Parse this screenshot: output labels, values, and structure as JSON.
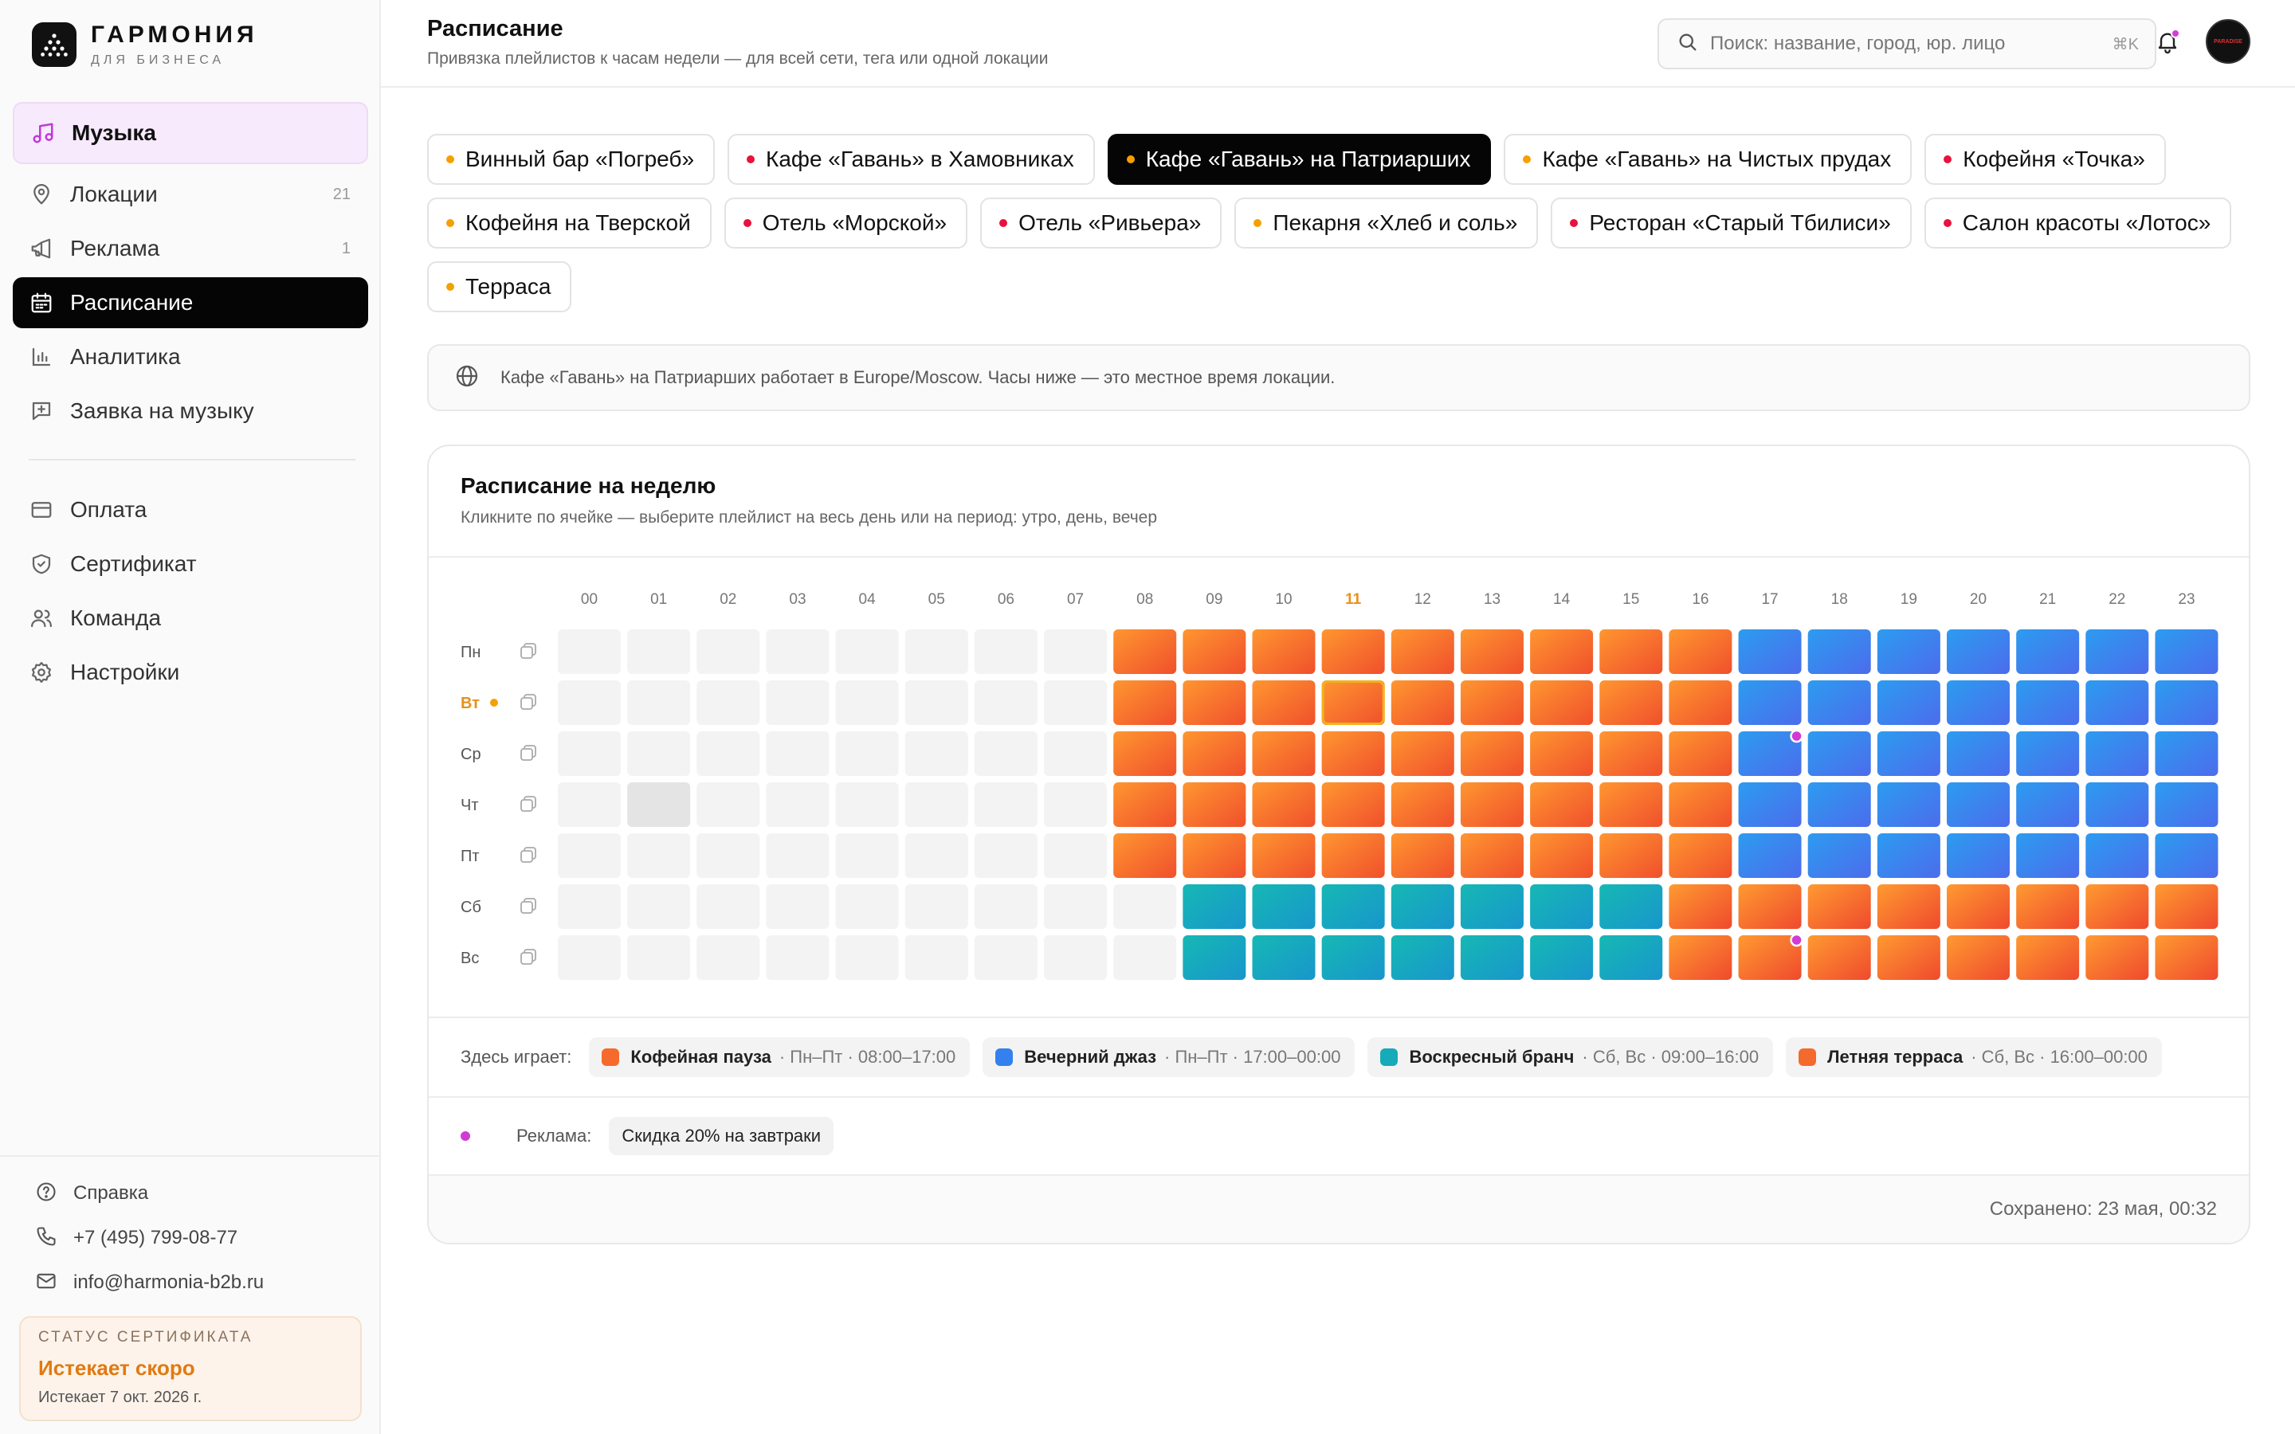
{
  "brand": {
    "name": "ГАРМОНИЯ",
    "sub": "ДЛЯ БИЗНЕСА"
  },
  "sidebar": {
    "music": "Музыка",
    "items": [
      {
        "label": "Локации",
        "count": "21",
        "icon": "map-pin-icon"
      },
      {
        "label": "Реклама",
        "count": "1",
        "icon": "megaphone-icon"
      },
      {
        "label": "Расписание",
        "count": "",
        "icon": "calendar-icon"
      },
      {
        "label": "Аналитика",
        "count": "",
        "icon": "bar-chart-icon"
      },
      {
        "label": "Заявка на музыку",
        "count": "",
        "icon": "request-icon"
      }
    ],
    "items2": [
      {
        "label": "Оплата",
        "icon": "credit-card-icon"
      },
      {
        "label": "Сертификат",
        "icon": "shield-icon"
      },
      {
        "label": "Команда",
        "icon": "users-icon"
      },
      {
        "label": "Настройки",
        "icon": "gear-icon"
      }
    ],
    "footer": [
      {
        "label": "Справка",
        "icon": "help-icon"
      },
      {
        "label": "+7 (495) 799-08-77",
        "icon": "phone-icon"
      },
      {
        "label": "info@harmonia-b2b.ru",
        "icon": "mail-icon"
      }
    ],
    "cert": {
      "label": "СТАТУС СЕРТИФИКАТА",
      "status": "Истекает скоро",
      "date": "Истекает 7 окт. 2026 г."
    }
  },
  "header": {
    "title": "Расписание",
    "subtitle": "Привязка плейлистов к часам недели — для всей сети, тега или одной локации",
    "search_placeholder": "Поиск: название, город, юр. лицо",
    "shortcut": "⌘K",
    "avatar_text": "PARADISE"
  },
  "locations": [
    {
      "name": "Винный бар «Погреб»",
      "dot": "#f5a000"
    },
    {
      "name": "Кафе «Гавань» в Хамовниках",
      "dot": "#e8123c"
    },
    {
      "name": "Кафе «Гавань» на Патриарших",
      "dot": "#f5a000",
      "active": true
    },
    {
      "name": "Кафе «Гавань» на Чистых прудах",
      "dot": "#f5a000"
    },
    {
      "name": "Кофейня «Точка»",
      "dot": "#e8123c"
    },
    {
      "name": "Кофейня на Тверской",
      "dot": "#f5a000"
    },
    {
      "name": "Отель «Морской»",
      "dot": "#e8123c"
    },
    {
      "name": "Отель «Ривьера»",
      "dot": "#e8123c"
    },
    {
      "name": "Пекарня «Хлеб и соль»",
      "dot": "#f5a000"
    },
    {
      "name": "Ресторан «Старый Тбилиси»",
      "dot": "#e8123c"
    },
    {
      "name": "Салон красоты «Лотос»",
      "dot": "#e8123c"
    },
    {
      "name": "Терраса",
      "dot": "#f5a000"
    }
  ],
  "tz_notice": "Кафе «Гавань» на Патриарших работает в Europe/Moscow. Часы ниже — это местное время локации.",
  "schedule": {
    "title": "Расписание на неделю",
    "subtitle": "Кликните по ячейке — выберите плейлист на весь день или на период: утро, день, вечер",
    "hours": [
      "00",
      "01",
      "02",
      "03",
      "04",
      "05",
      "06",
      "07",
      "08",
      "09",
      "10",
      "11",
      "12",
      "13",
      "14",
      "15",
      "16",
      "17",
      "18",
      "19",
      "20",
      "21",
      "22",
      "23"
    ],
    "current_hour": "11",
    "days": [
      "Пн",
      "Вт",
      "Ср",
      "Чт",
      "Пт",
      "Сб",
      "Вс"
    ],
    "current_day": "Вт",
    "rows": [
      "........CCCCCCCCCJJJJJJJ",
      "........CCCCCCCCCJJJJJJJ",
      "........CCCCCCCCCJJJJJJJ",
      "........CCCCCCCCCJJJJJJJ",
      "........CCCCCCCCCJJJJJJJ",
      ".........BBBBBBBTTTTTTTT",
      ".........BBBBBBBTTTTTTTT"
    ],
    "playlist_colors": {
      "C": [
        "#ff9630",
        "#f0502c"
      ],
      "J": [
        "#2c9cf0",
        "#4c6cec"
      ],
      "B": [
        "#16b8b4",
        "#1896cc"
      ],
      "T": [
        "#ff9a30",
        "#ef4a2e"
      ]
    },
    "selected_cell": {
      "day": "Вт",
      "hour": "11"
    },
    "hover_cell": {
      "day": "Чт",
      "hour": "01"
    },
    "ad_slots": [
      {
        "day": "Ср",
        "hour": "17"
      },
      {
        "day": "Вс",
        "hour": "17"
      }
    ],
    "ad_color": "#d23ad6"
  },
  "legend": {
    "label": "Здесь играет:",
    "items": [
      {
        "name": "Кофейная пауза",
        "time": "· Пн–Пт · 08:00–17:00",
        "color": "#f66a2c"
      },
      {
        "name": "Вечерний джаз",
        "time": "· Пн–Пт · 17:00–00:00",
        "color": "#3480ee"
      },
      {
        "name": "Воскресный бранч",
        "time": "· Сб, Вс · 09:00–16:00",
        "color": "#17aab8"
      },
      {
        "name": "Летняя терраса",
        "time": "· Сб, Вс · 16:00–00:00",
        "color": "#f46a2c"
      }
    ]
  },
  "ads": {
    "label": "Реклама:",
    "item": "Скидка 20% на завтраки"
  },
  "saved": "Сохранено: 23 мая, 00:32"
}
